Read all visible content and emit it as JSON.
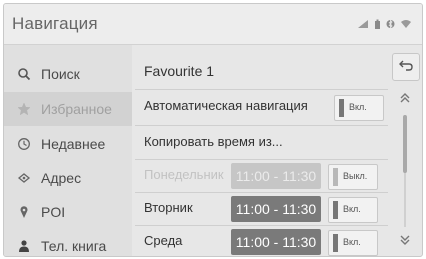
{
  "header": {
    "title": "Навигация"
  },
  "status_icons": [
    "signal-icon",
    "battery-icon",
    "bluetooth-icon",
    "wifi-icon"
  ],
  "sidebar": {
    "items": [
      {
        "label": "Поиск",
        "icon": "search-icon"
      },
      {
        "label": "Избранное",
        "icon": "star-icon",
        "active": true
      },
      {
        "label": "Недавнее",
        "icon": "clock-icon"
      },
      {
        "label": "Адрес",
        "icon": "address-icon"
      },
      {
        "label": "POI",
        "icon": "poi-pin-icon"
      },
      {
        "label": "Тел. книга",
        "icon": "person-icon"
      }
    ]
  },
  "main": {
    "favourite_name": "Favourite 1",
    "auto_nav": {
      "label": "Автоматическая навигация",
      "toggle": "Вкл."
    },
    "copy_time": "Копировать время из...",
    "days": [
      {
        "label": "Понедельник",
        "time": "11:00 - 11:30",
        "toggle": "Выкл.",
        "enabled": false
      },
      {
        "label": "Вторник",
        "time": "11:00 - 11:30",
        "toggle": "Вкл.",
        "enabled": true
      },
      {
        "label": "Среда",
        "time": "11:00 - 11:30",
        "toggle": "Вкл.",
        "enabled": true
      }
    ]
  },
  "colors": {
    "screen_bg": "#e7e7e7",
    "time_chip": "#7a7a7a",
    "time_chip_disabled": "#c6c6c6"
  }
}
